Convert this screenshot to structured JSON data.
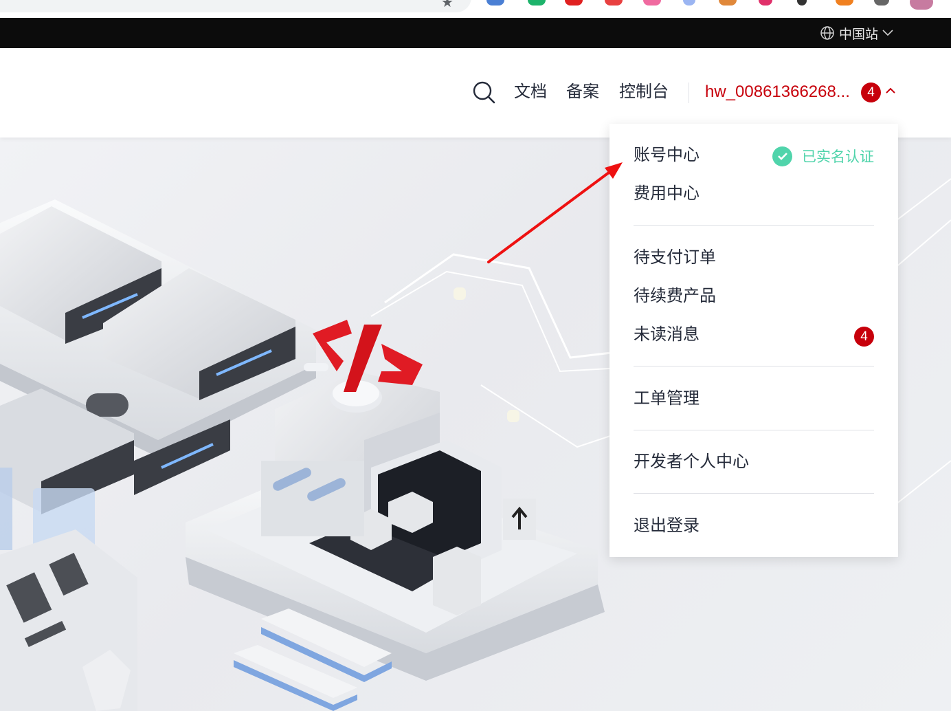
{
  "top_bar": {
    "region_label": "中国站"
  },
  "header": {
    "nav": [
      "文档",
      "备案",
      "控制台"
    ],
    "username": "hw_00861366268...",
    "notification_count": "4"
  },
  "account_menu": {
    "account_center": "账号中心",
    "verified_label": "已实名认证",
    "billing_center": "费用中心",
    "pending_orders": "待支付订单",
    "renewal_products": "待续费产品",
    "unread_messages": "未读消息",
    "unread_count": "4",
    "tickets": "工单管理",
    "developer_center": "开发者个人中心",
    "logout": "退出登录"
  },
  "colors": {
    "brand_red": "#c7000b",
    "verified_green": "#50d4ab",
    "text_dark": "#252b3a"
  }
}
